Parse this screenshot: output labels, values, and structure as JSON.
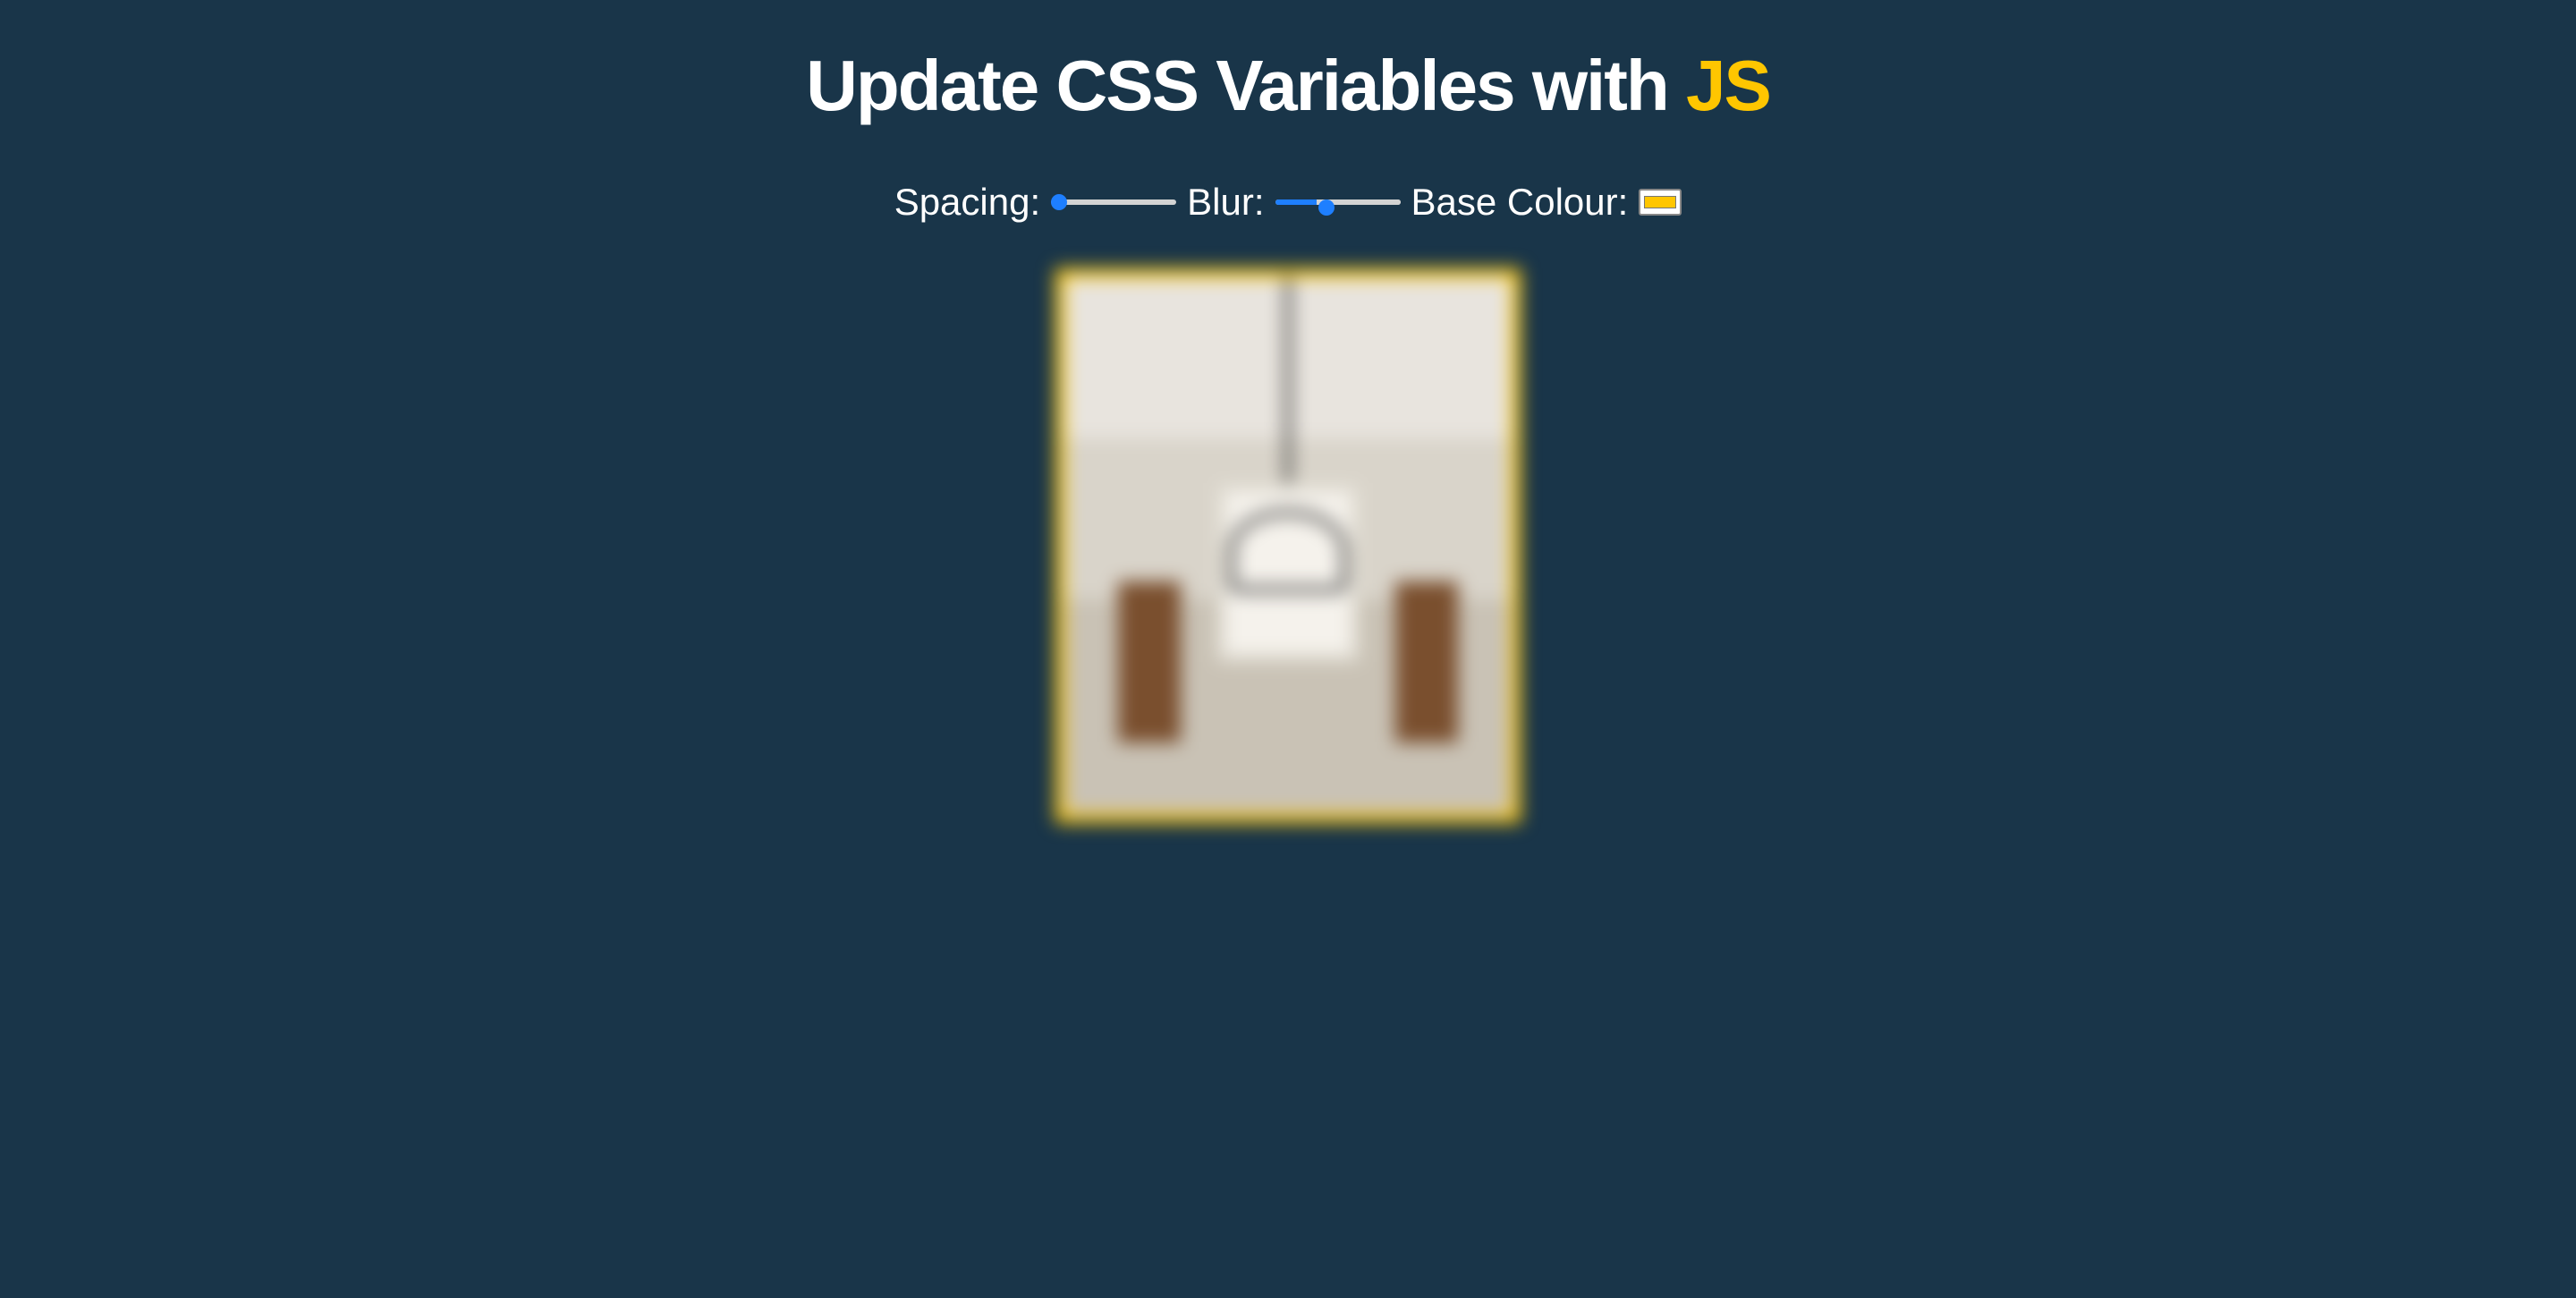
{
  "heading": {
    "prefix": "Update CSS Variables with ",
    "highlight": "JS"
  },
  "controls": {
    "spacing": {
      "label": "Spacing:",
      "min": 10,
      "max": 200,
      "value": 10
    },
    "blur": {
      "label": "Blur:",
      "min": 0,
      "max": 25,
      "value": 10
    },
    "base": {
      "label": "Base Colour:",
      "value": "#ffc600"
    }
  },
  "colors": {
    "background": "#193549",
    "accent": "#ffc600",
    "text": "#ffffff"
  }
}
